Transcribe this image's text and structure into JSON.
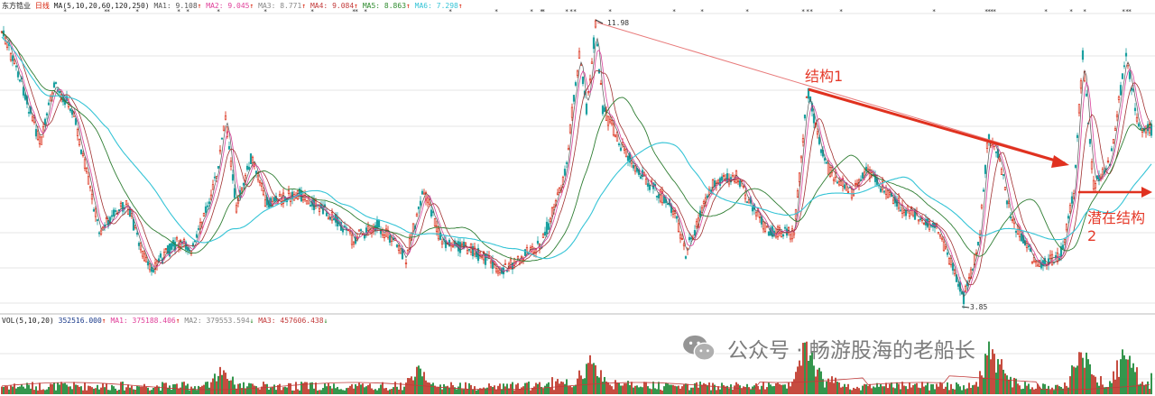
{
  "header": {
    "symbol": "东方锆业",
    "period": "日线",
    "ma_label": "MA(5,10,20,60,120,250)",
    "ma_values": [
      {
        "name": "MA1",
        "value": "9.108",
        "arrow": "↑",
        "color": "#7a7a7a"
      },
      {
        "name": "MA2",
        "value": "9.045",
        "arrow": "↑",
        "color": "#e0409a"
      },
      {
        "name": "MA3",
        "value": "8.771",
        "arrow": "↑",
        "color": "#8a8a8a"
      },
      {
        "name": "MA4",
        "value": "9.084",
        "arrow": "↑",
        "color": "#c23a3a"
      },
      {
        "name": "MA5",
        "value": "8.863",
        "arrow": "↑",
        "color": "#2e8b2e"
      },
      {
        "name": "MA6",
        "value": "7.298",
        "arrow": "↑",
        "color": "#35c4d6"
      }
    ]
  },
  "volume_header": {
    "label": "VOL(5,10,20)",
    "value": "352516.000",
    "value_arrow": "↑",
    "mas": [
      {
        "name": "MA1",
        "value": "375188.406",
        "arrow": "↑",
        "color": "#e0409a"
      },
      {
        "name": "MA2",
        "value": "379553.594",
        "arrow": "↓",
        "color": "#8a8a8a"
      },
      {
        "name": "MA3",
        "value": "457606.438",
        "arrow": "↓",
        "color": "#c23a3a"
      }
    ]
  },
  "price_labels": {
    "high": "11.98",
    "low": "3.85"
  },
  "annotations": {
    "structure1": "结构1",
    "potential_line1": "潜在结构",
    "potential_line2": "2"
  },
  "watermark": {
    "text": "公众号 · 畅游股海的老船长"
  },
  "colors": {
    "up": "#d81e06",
    "down": "#1aa0a0",
    "ma_cyan": "#35c4d6",
    "ma_green": "#2e7d32",
    "ma_red": "#a03030",
    "ma_magenta": "#d8409a",
    "arrow": "#e0311f",
    "grid": "#e4e4e4",
    "vol_up": "#c0392b",
    "vol_down": "#1e8a3a"
  },
  "chart_data": {
    "type": "candlestick",
    "price_high": 11.98,
    "price_low": 3.85,
    "grid": true
  }
}
